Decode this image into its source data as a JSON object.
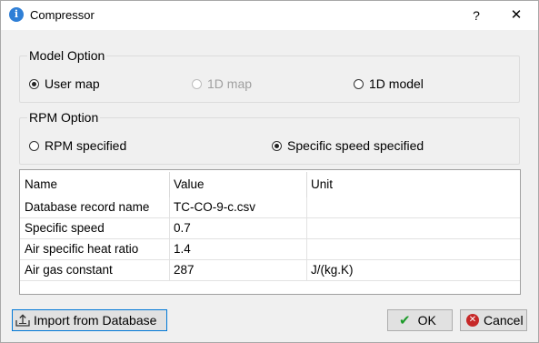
{
  "window": {
    "title": "Compressor",
    "help_label": "?",
    "close_label": "✕"
  },
  "model_option": {
    "title": "Model Option",
    "options": [
      {
        "label": "User map",
        "checked": true,
        "disabled": false
      },
      {
        "label": "1D map",
        "checked": false,
        "disabled": true
      },
      {
        "label": "1D model",
        "checked": false,
        "disabled": false
      }
    ]
  },
  "rpm_option": {
    "title": "RPM Option",
    "options": [
      {
        "label": "RPM specified",
        "checked": false
      },
      {
        "label": "Specific speed specified",
        "checked": true
      }
    ]
  },
  "table": {
    "columns": [
      "Name",
      "Value",
      "Unit"
    ],
    "rows": [
      [
        "Database record name",
        "TC-CO-9-c.csv",
        ""
      ],
      [
        "Specific speed",
        "0.7",
        ""
      ],
      [
        "Air specific heat ratio",
        "1.4",
        ""
      ],
      [
        "Air gas constant",
        "287",
        "J/(kg.K)"
      ]
    ]
  },
  "buttons": {
    "import_label": "Import from Database",
    "ok_label": "OK",
    "cancel_label": "Cancel"
  },
  "icons": {
    "app": "info-icon",
    "import": "upload-icon",
    "ok": "checkmark-icon",
    "cancel": "cancel-circle-icon"
  },
  "colors": {
    "accent": "#0078d7",
    "ok_green": "#1d9b2a",
    "cancel_red": "#c62828",
    "app_icon_blue": "#2f7fd6"
  }
}
